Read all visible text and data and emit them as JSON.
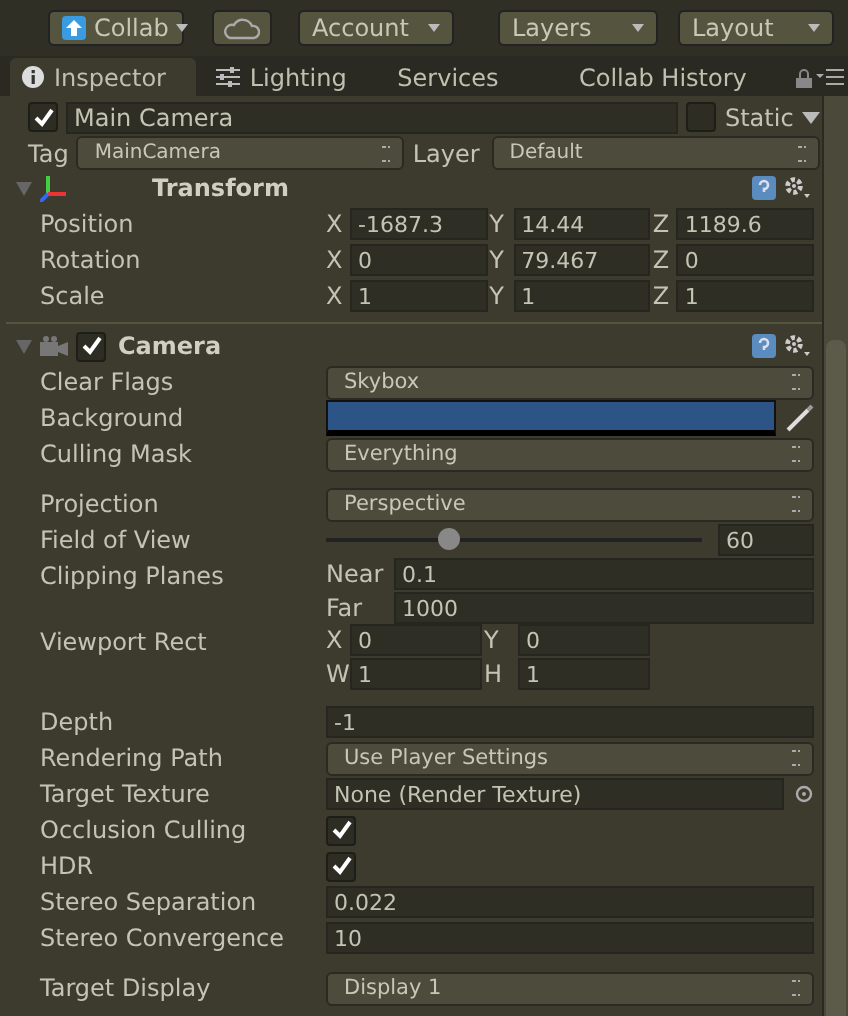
{
  "toolbar": {
    "collab": "Collab",
    "account": "Account",
    "layers": "Layers",
    "layout": "Layout"
  },
  "tabs": [
    {
      "label": "Inspector",
      "selected": true
    },
    {
      "label": "Lighting",
      "selected": false
    },
    {
      "label": "Services",
      "selected": false
    },
    {
      "label": "Collab History",
      "selected": false
    }
  ],
  "object": {
    "active": true,
    "name": "Main Camera",
    "static": false,
    "static_label": "Static",
    "tag_label": "Tag",
    "tag": "MainCamera",
    "layer_label": "Layer",
    "layer": "Default"
  },
  "transform": {
    "title": "Transform",
    "expanded": true,
    "rows": [
      {
        "label": "Position",
        "fields": [
          {
            "label": "X",
            "value": "-1687.3"
          },
          {
            "label": "Y",
            "value": "14.44"
          },
          {
            "label": "Z",
            "value": "1189.6"
          }
        ]
      },
      {
        "label": "Rotation",
        "fields": [
          {
            "label": "X",
            "value": "0"
          },
          {
            "label": "Y",
            "value": "79.467"
          },
          {
            "label": "Z",
            "value": "0"
          }
        ]
      },
      {
        "label": "Scale",
        "fields": [
          {
            "label": "X",
            "value": "1"
          },
          {
            "label": "Y",
            "value": "1"
          },
          {
            "label": "Z",
            "value": "1"
          }
        ]
      }
    ]
  },
  "camera": {
    "title": "Camera",
    "enabled": true,
    "expanded": true,
    "groups": [
      [
        {
          "kind": "dropdown",
          "label": "Clear Flags",
          "value": "Skybox"
        },
        {
          "kind": "color",
          "label": "Background",
          "color": "#2c5486"
        },
        {
          "kind": "dropdown",
          "label": "Culling Mask",
          "value": "Everything"
        }
      ],
      [
        {
          "kind": "dropdown",
          "label": "Projection",
          "value": "Perspective"
        },
        {
          "kind": "slider",
          "label": "Field of View",
          "level": 0.33,
          "value": "60"
        },
        {
          "kind": "pair",
          "label": "Clipping Planes",
          "fields": [
            {
              "label": "Near",
              "value": "0.1"
            },
            {
              "label": "Far",
              "value": "1000"
            }
          ]
        },
        {
          "kind": "rect",
          "label": "Viewport Rect",
          "fields": [
            {
              "label": "X",
              "value": "0"
            },
            {
              "label": "Y",
              "value": "0"
            },
            {
              "label": "W",
              "value": "1"
            },
            {
              "label": "H",
              "value": "1"
            }
          ]
        }
      ],
      [
        {
          "kind": "text",
          "label": "Depth",
          "value": "-1"
        },
        {
          "kind": "dropdown",
          "label": "Rendering Path",
          "value": "Use Player Settings"
        },
        {
          "kind": "object",
          "label": "Target Texture",
          "value": "None (Render Texture)"
        },
        {
          "kind": "checkbox",
          "label": "Occlusion Culling",
          "checked": true
        },
        {
          "kind": "checkbox",
          "label": "HDR",
          "checked": true
        },
        {
          "kind": "text",
          "label": "Stereo Separation",
          "value": "0.022"
        },
        {
          "kind": "text",
          "label": "Stereo Convergence",
          "value": "10"
        }
      ],
      [
        {
          "kind": "dropdown",
          "label": "Target Display",
          "value": "Display 1"
        }
      ]
    ]
  }
}
